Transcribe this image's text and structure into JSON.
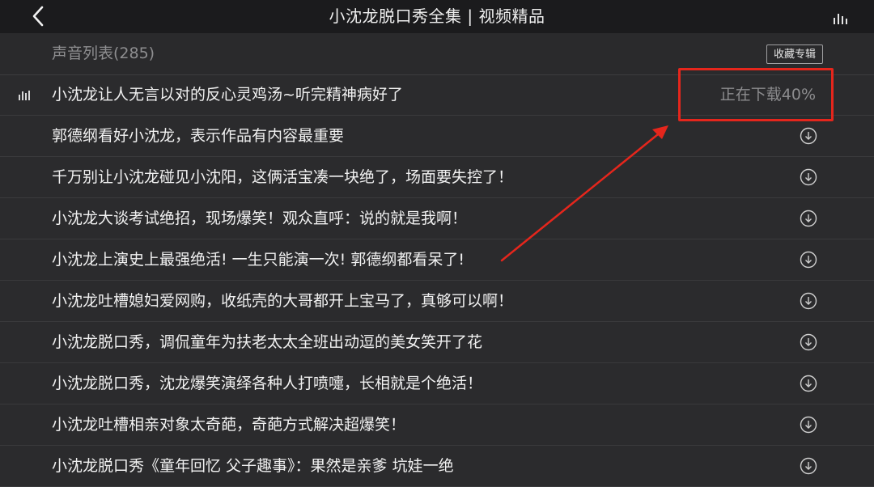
{
  "header": {
    "title": "小沈龙脱口秀全集 | 视频精品"
  },
  "section": {
    "label": "声音列表(285)",
    "collect_label": "收藏专辑"
  },
  "tracks": [
    {
      "title": "小沈龙让人无言以对的反心灵鸡汤~听完精神病好了",
      "status": "正在下载40%",
      "download_progress": 40,
      "playing": true
    },
    {
      "title": "郭德纲看好小沈龙，表示作品有内容最重要"
    },
    {
      "title": "千万别让小沈龙碰见小沈阳，这俩活宝凑一块绝了，场面要失控了！"
    },
    {
      "title": "小沈龙大谈考试绝招，现场爆笑！观众直呼：说的就是我啊！"
    },
    {
      "title": "小沈龙上演史上最强绝活! 一生只能演一次! 郭德纲都看呆了!"
    },
    {
      "title": "小沈龙吐槽媳妇爱网购，收纸壳的大哥都开上宝马了，真够可以啊！"
    },
    {
      "title": "小沈龙脱口秀，调侃童年为扶老太太全班出动逗的美女笑开了花"
    },
    {
      "title": "小沈龙脱口秀，沈龙爆笑演绎各种人打喷嚏，长相就是个绝活！"
    },
    {
      "title": "小沈龙吐槽相亲对象太奇葩，奇葩方式解决超爆笑！"
    },
    {
      "title": "小沈龙脱口秀《童年回忆 父子趣事》：果然是亲爹 坑娃一绝"
    }
  ],
  "colors": {
    "background": "#2b2b2d",
    "topbar": "#1b1b1d",
    "annotation": "#e5261c"
  },
  "icons": {
    "back": "chevron-left-icon",
    "equalizer": "equalizer-icon",
    "download": "download-circle-icon"
  }
}
